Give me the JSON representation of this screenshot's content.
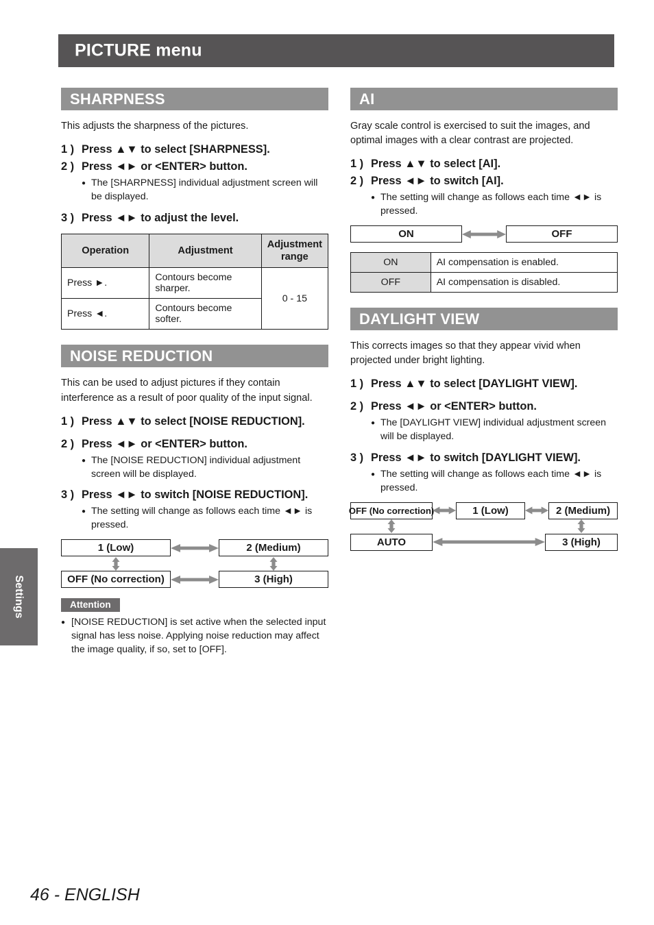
{
  "side_tab": {
    "label": "Settings"
  },
  "header": {
    "title": "PICTURE menu"
  },
  "footer": {
    "text": "46 - ENGLISH"
  },
  "sharpness": {
    "heading": "SHARPNESS",
    "intro": "This adjusts the sharpness of the pictures.",
    "steps": [
      {
        "num": "1 )",
        "text": "Press ▲▼ to select [SHARPNESS]."
      },
      {
        "num": "2 )",
        "text": "Press ◄► or <ENTER> button.",
        "sub": "The [SHARPNESS] individual adjustment screen will be displayed."
      },
      {
        "num": "3 )",
        "text": "Press ◄► to adjust the level."
      }
    ],
    "table": {
      "headers": [
        "Operation",
        "Adjustment",
        "Adjustment range"
      ],
      "rows": [
        {
          "operation": "Press ►.",
          "adjustment": "Contours become sharper."
        },
        {
          "operation": "Press ◄.",
          "adjustment": "Contours become softer."
        }
      ],
      "range": "0 - 15"
    }
  },
  "noise_reduction": {
    "heading": "NOISE REDUCTION",
    "intro": "This can be used to adjust pictures if they contain interference as a result of poor quality of the input signal.",
    "steps": [
      {
        "num": "1 )",
        "text": "Press ▲▼ to select [NOISE REDUCTION]."
      },
      {
        "num": "2 )",
        "text": "Press ◄► or <ENTER> button.",
        "sub": "The [NOISE REDUCTION] individual adjustment screen will be displayed."
      },
      {
        "num": "3 )",
        "text": "Press ◄► to switch [NOISE REDUCTION].",
        "sub": "The setting will change as follows each time ◄► is pressed."
      }
    ],
    "diagram": {
      "top_left": "1 (Low)",
      "top_right": "2 (Medium)",
      "bottom_left": "OFF (No correction)",
      "bottom_right": "3 (High)"
    },
    "attention": {
      "label": "Attention",
      "text": "[NOISE REDUCTION] is set active when the selected input signal has less noise. Applying noise reduction may affect the image quality, if so, set to [OFF]."
    }
  },
  "ai": {
    "heading": "AI",
    "intro": "Gray scale control is exercised to suit the images, and optimal images with a clear contrast are projected.",
    "steps": [
      {
        "num": "1 )",
        "text": "Press ▲▼ to select [AI]."
      },
      {
        "num": "2 )",
        "text": "Press ◄► to switch [AI].",
        "sub": "The setting will change as follows each time ◄► is pressed."
      }
    ],
    "diagram": {
      "left": "ON",
      "right": "OFF"
    },
    "table": {
      "rows": [
        {
          "value": "ON",
          "description": "AI compensation is enabled."
        },
        {
          "value": "OFF",
          "description": "AI compensation is disabled."
        }
      ]
    }
  },
  "daylight_view": {
    "heading": "DAYLIGHT VIEW",
    "intro": "This corrects images so that they appear vivid when projected under bright lighting.",
    "steps": [
      {
        "num": "1 )",
        "text": "Press ▲▼ to select [DAYLIGHT VIEW]."
      },
      {
        "num": "2 )",
        "text": "Press ◄► or <ENTER> button.",
        "sub": "The [DAYLIGHT VIEW] individual adjustment screen will be displayed."
      },
      {
        "num": "3 )",
        "text": "Press ◄► to switch [DAYLIGHT VIEW].",
        "sub": "The setting will change as follows each time ◄► is pressed."
      }
    ],
    "diagram": {
      "top_1": "OFF (No correction)",
      "top_2": "1 (Low)",
      "top_3": "2 (Medium)",
      "bottom_left": "AUTO",
      "bottom_right": "3 (High)"
    }
  },
  "colors": {
    "header_bar": "#565455",
    "section_bar": "#929292",
    "table_header": "#dcdcdc",
    "arrow": "#8c8c8c",
    "side_tab": "#6d6b6c"
  }
}
